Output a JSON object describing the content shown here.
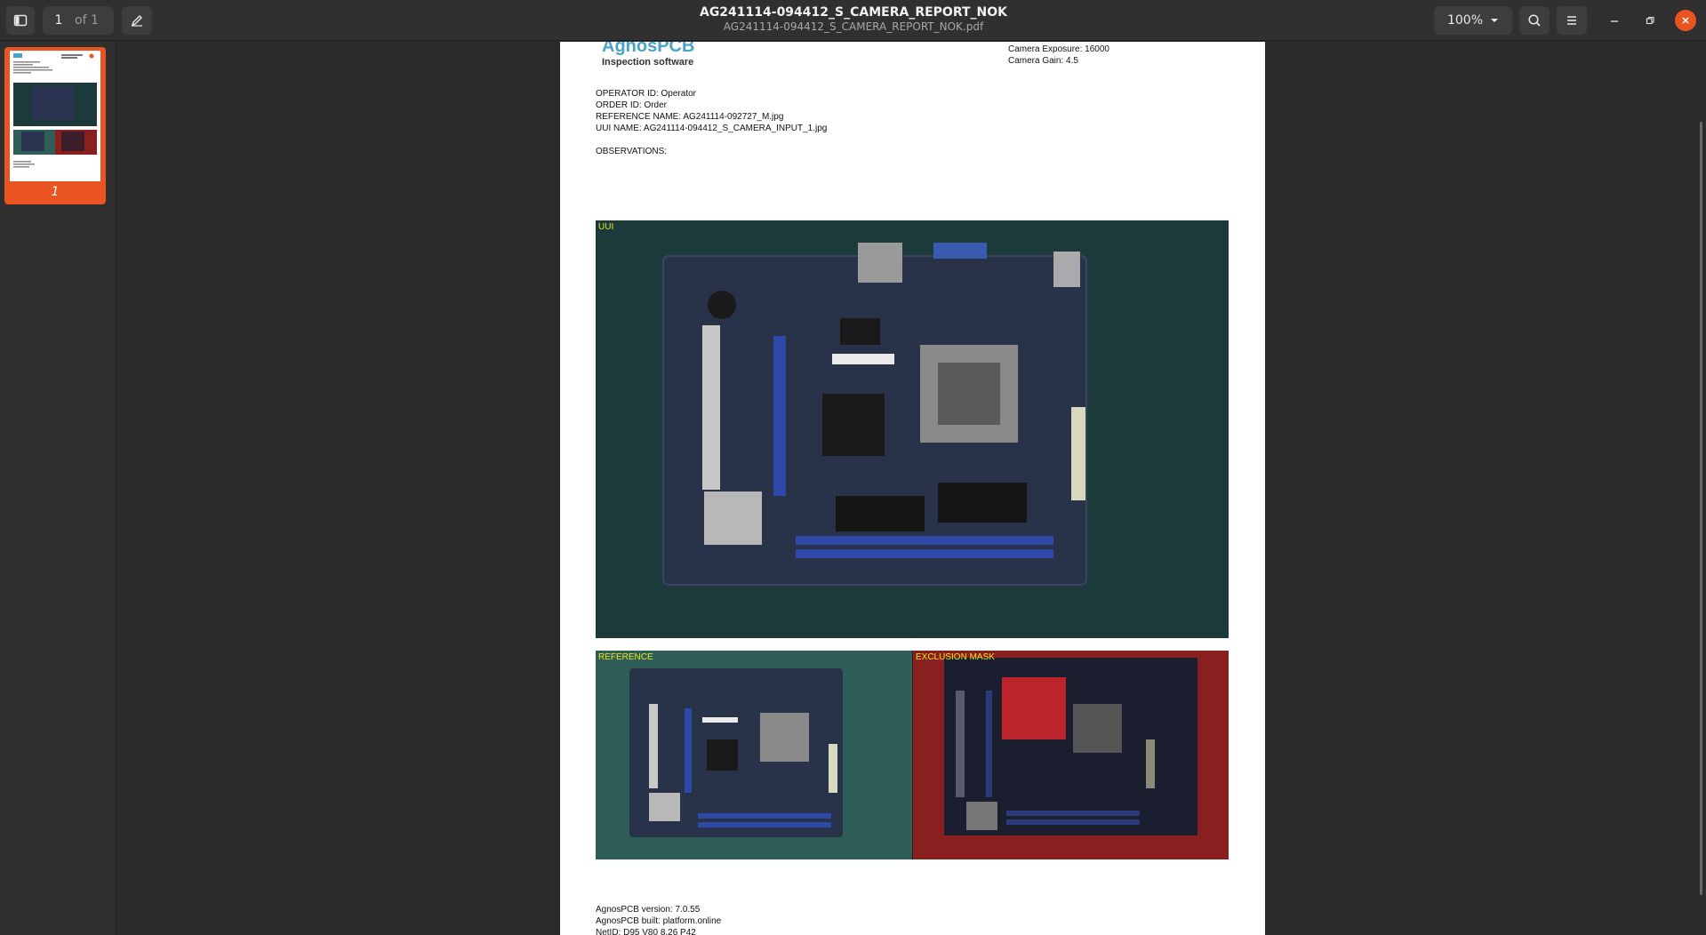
{
  "header": {
    "page_current": "1",
    "page_of": "of 1",
    "title": "AG241114-094412_S_CAMERA_REPORT_NOK",
    "subtitle": "AG241114-094412_S_CAMERA_REPORT_NOK.pdf",
    "zoom": "100%",
    "icons": [
      "sidebar-toggle-icon",
      "pen-icon",
      "search-icon",
      "hamburger-menu-icon",
      "minimize-icon",
      "restore-icon",
      "close-icon"
    ]
  },
  "sidebar": {
    "thumbnail_page_label": "1",
    "bottom_icons": [
      "grid-icon",
      "annotate-icon",
      "layers-icon"
    ]
  },
  "document": {
    "logo_name": "AgnosPCB",
    "logo_sub": "Inspection software",
    "camera_exposure": "Camera Exposure: 16000",
    "camera_gain": "Camera Gain: 4.5",
    "operator_id": "OPERATOR ID: Operator",
    "order_id": "ORDER ID: Order",
    "reference_name": "REFERENCE NAME: AG241114-092727_M.jpg",
    "uui_name": "UUI NAME: AG241114-094412_S_CAMERA_INPUT_1.jpg",
    "observations": "OBSERVATIONS:",
    "uui_label": "UUI",
    "reference_label": "REFERENCE",
    "exclusion_label": "EXCLUSION MASK",
    "footer_version": "AgnosPCB version: 7.0.55",
    "footer_built": "AgnosPCB built: platform.online",
    "footer_netid": "NetID: D95 V80 8.26 P42"
  },
  "colors": {
    "accent": "#e95420",
    "header_bg": "#303030",
    "viewer_bg": "#2b2b2b",
    "uui_bg": "#1d3a3a",
    "reference_bg": "#2f5d58",
    "exclusion_bg": "#8a1f1f",
    "label_yellow": "#e6e61a"
  }
}
